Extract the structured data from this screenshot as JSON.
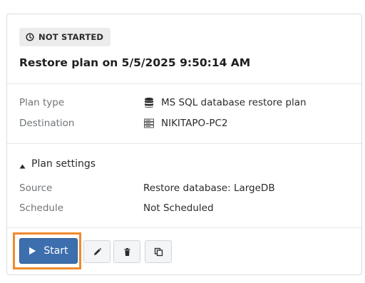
{
  "status": {
    "label": "NOT STARTED",
    "icon": "clock-icon"
  },
  "title": "Restore plan on 5/5/2025 9:50:14 AM",
  "info": {
    "plan_type": {
      "label": "Plan type",
      "value": "MS SQL database restore plan",
      "icon": "database-icon"
    },
    "destination": {
      "label": "Destination",
      "value": "NIKITAPO-PC2",
      "icon": "server-icon"
    }
  },
  "settings": {
    "toggle_label": "Plan settings",
    "expanded": true,
    "source": {
      "label": "Source",
      "value": "Restore database: LargeDB"
    },
    "schedule": {
      "label": "Schedule",
      "value": "Not Scheduled"
    }
  },
  "actions": {
    "start_label": "Start",
    "edit_icon": "pencil-icon",
    "delete_icon": "trash-icon",
    "copy_icon": "copy-icon"
  },
  "colors": {
    "primary": "#3d6fae",
    "highlight": "#f08a2c",
    "badge_bg": "#ececec",
    "label_text": "#707478"
  }
}
